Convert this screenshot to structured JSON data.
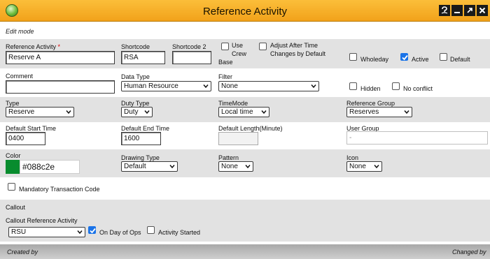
{
  "window": {
    "title": "Reference Activity",
    "accent": "#f2a21a",
    "buttons": [
      "help",
      "minimize",
      "maximize",
      "close"
    ]
  },
  "mode": "Edit mode",
  "fields": {
    "reference_activity": {
      "label": "Reference Activity",
      "required_mark": "*",
      "value": "Reserve A"
    },
    "shortcode": {
      "label": "Shortcode",
      "value": "RSA"
    },
    "shortcode2": {
      "label": "Shortcode 2",
      "value": ""
    },
    "use_crew_base": {
      "label_line1": "Use",
      "label_line2": "Crew",
      "label_line3": "Base",
      "checked": false
    },
    "adjust_after_time": {
      "label_line1": "Adjust After Time",
      "label_line2": "Changes by Default",
      "checked": false
    },
    "wholeday": {
      "label": "Wholeday",
      "checked": false
    },
    "active": {
      "label": "Active",
      "checked": true
    },
    "default": {
      "label": "Default",
      "checked": false
    },
    "comment": {
      "label": "Comment",
      "value": ""
    },
    "data_type": {
      "label": "Data Type",
      "value": "Human Resource"
    },
    "filter": {
      "label": "Filter",
      "value": "None"
    },
    "hidden": {
      "label": "Hidden",
      "checked": false
    },
    "no_conflict": {
      "label": "No conflict",
      "checked": false
    },
    "type": {
      "label": "Type",
      "value": "Reserve"
    },
    "duty_type": {
      "label": "Duty Type",
      "value": "Duty"
    },
    "timemode": {
      "label": "TimeMode",
      "value": "Local time"
    },
    "reference_group": {
      "label": "Reference Group",
      "value": "Reserves"
    },
    "default_start_time": {
      "label": "Default Start Time",
      "value": "0400"
    },
    "default_end_time": {
      "label": "Default End Time",
      "value": "1600"
    },
    "default_length": {
      "label": "Default Length(Minute)",
      "value": ""
    },
    "user_group": {
      "label": "User Group",
      "value": "-"
    },
    "color": {
      "label": "Color",
      "value": "#088c2e",
      "swatch": "#088c2e"
    },
    "drawing_type": {
      "label": "Drawing Type",
      "value": "Default"
    },
    "pattern": {
      "label": "Pattern",
      "value": "None"
    },
    "icon": {
      "label": "Icon",
      "value": "None"
    },
    "mandatory_transaction_code": {
      "label": "Mandatory Transaction Code",
      "checked": false
    }
  },
  "callout": {
    "section_label": "Callout",
    "reference_label": "Callout Reference Activity",
    "reference_value": "RSU",
    "on_day_of_ops": {
      "label": "On Day of Ops",
      "checked": true
    },
    "activity_started": {
      "label": "Activity Started",
      "checked": false
    }
  },
  "footer": {
    "created_by": "Created by",
    "changed_by": "Changed by"
  }
}
